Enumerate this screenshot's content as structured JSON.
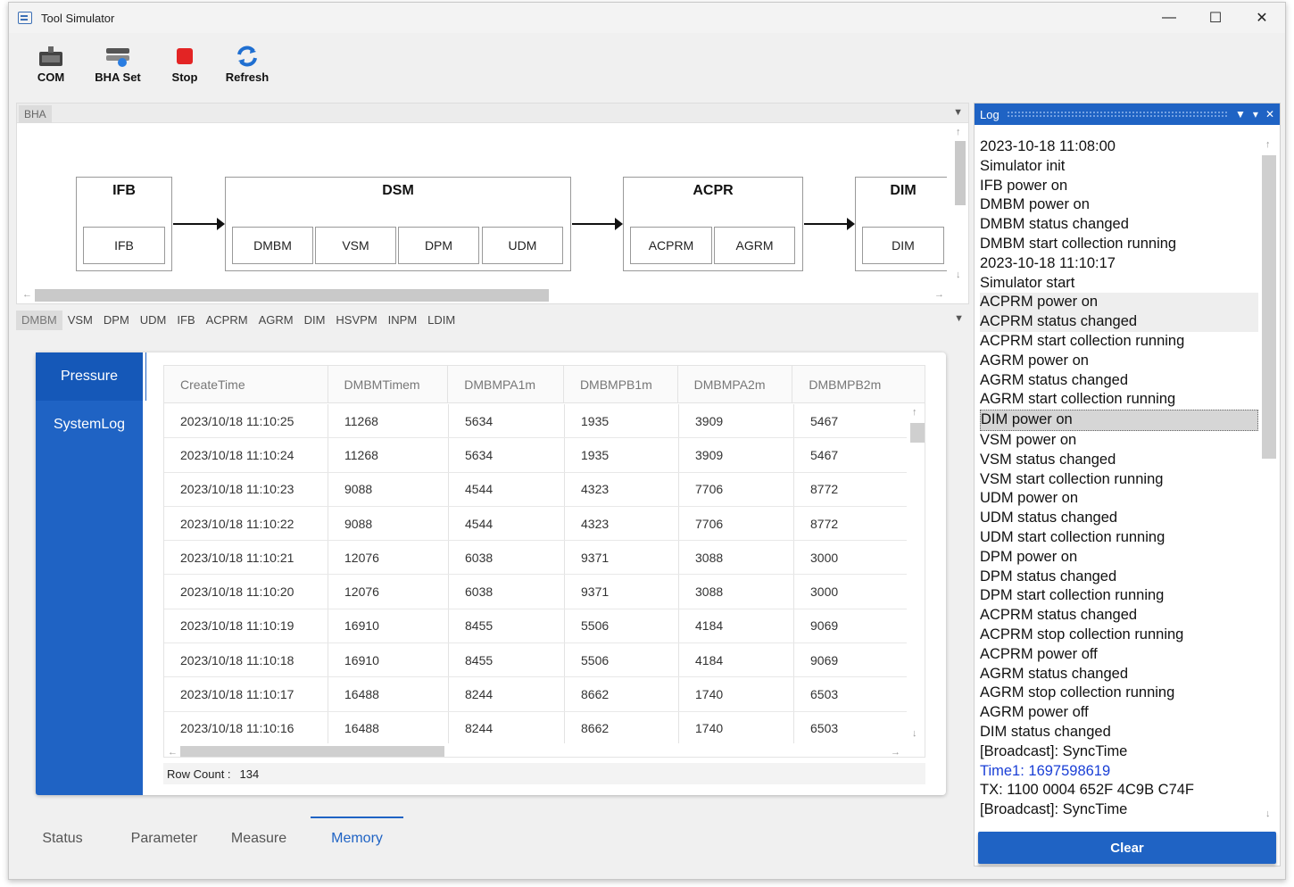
{
  "window": {
    "title": "Tool Simulator"
  },
  "toolbar": {
    "com": "COM",
    "bha_set": "BHA Set",
    "stop": "Stop",
    "refresh": "Refresh"
  },
  "bha_panel": {
    "tab": "BHA",
    "modules": [
      {
        "name": "IFB",
        "subs": [
          "IFB"
        ]
      },
      {
        "name": "DSM",
        "subs": [
          "DMBM",
          "VSM",
          "DPM",
          "UDM"
        ]
      },
      {
        "name": "ACPR",
        "subs": [
          "ACPRM",
          "AGRM"
        ]
      },
      {
        "name": "DIM",
        "subs": [
          "DIM"
        ]
      }
    ]
  },
  "module_tabs": [
    "DMBM",
    "VSM",
    "DPM",
    "UDM",
    "IFB",
    "ACPRM",
    "AGRM",
    "DIM",
    "HSVPM",
    "INPM",
    "LDIM"
  ],
  "side_nav": [
    "Pressure",
    "SystemLog"
  ],
  "grid": {
    "columns": [
      "CreateTime",
      "DMBMTimem",
      "DMBMPA1m",
      "DMBMPB1m",
      "DMBMPA2m",
      "DMBMPB2m"
    ],
    "rows": [
      [
        "2023/10/18 11:10:25",
        "11268",
        "5634",
        "1935",
        "3909",
        "5467"
      ],
      [
        "2023/10/18 11:10:24",
        "11268",
        "5634",
        "1935",
        "3909",
        "5467"
      ],
      [
        "2023/10/18 11:10:23",
        "9088",
        "4544",
        "4323",
        "7706",
        "8772"
      ],
      [
        "2023/10/18 11:10:22",
        "9088",
        "4544",
        "4323",
        "7706",
        "8772"
      ],
      [
        "2023/10/18 11:10:21",
        "12076",
        "6038",
        "9371",
        "3088",
        "3000"
      ],
      [
        "2023/10/18 11:10:20",
        "12076",
        "6038",
        "9371",
        "3088",
        "3000"
      ],
      [
        "2023/10/18 11:10:19",
        "16910",
        "8455",
        "5506",
        "4184",
        "9069"
      ],
      [
        "2023/10/18 11:10:18",
        "16910",
        "8455",
        "5506",
        "4184",
        "9069"
      ],
      [
        "2023/10/18 11:10:17",
        "16488",
        "8244",
        "8662",
        "1740",
        "6503"
      ],
      [
        "2023/10/18 11:10:16",
        "16488",
        "8244",
        "8662",
        "1740",
        "6503"
      ]
    ],
    "row_count_label": "Row Count :",
    "row_count": "134"
  },
  "bottom_tabs": [
    "Status",
    "Parameter",
    "Measure",
    "Memory"
  ],
  "log": {
    "title": "Log",
    "lines": [
      "2023-10-18 11:08:00",
      "Simulator init",
      "IFB power on",
      "DMBM power on",
      "DMBM status changed",
      "DMBM start collection running",
      "2023-10-18 11:10:17",
      "Simulator start",
      "ACPRM power on",
      "ACPRM status changed",
      "ACPRM start collection running",
      "AGRM power on",
      "AGRM status changed",
      "AGRM start collection running",
      "DIM power on",
      "VSM power on",
      "VSM status changed",
      "VSM start collection running",
      "UDM power on",
      "UDM status changed",
      "UDM start collection running",
      "DPM power on",
      "DPM status changed",
      "DPM start collection running",
      "ACPRM status changed",
      "ACPRM stop collection running",
      "ACPRM power off",
      "AGRM status changed",
      "AGRM stop collection running",
      "AGRM power off",
      "DIM status changed",
      "[Broadcast]: SyncTime",
      "Time1: 1697598619",
      "TX: 1100 0004 652F 4C9B C74F",
      "[Broadcast]: SyncTime"
    ],
    "clear_label": "Clear"
  },
  "colors": {
    "accent": "#1f63c4",
    "log_link": "#1a3fd6"
  }
}
